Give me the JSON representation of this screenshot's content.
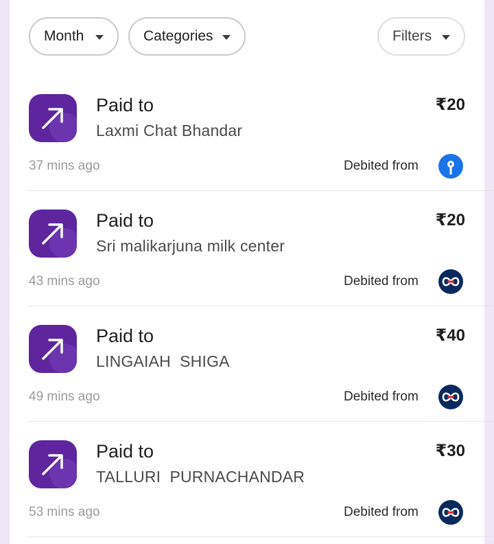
{
  "filters": {
    "month_label": "Month",
    "categories_label": "Categories",
    "filters_label": "Filters"
  },
  "transactions": [
    {
      "type_label": "Paid to",
      "payee": "Laxmi Chat Bhandar",
      "amount": "₹20",
      "time": "37 mins ago",
      "debited_label": "Debited from",
      "bank_icon": "sbi-bank-icon"
    },
    {
      "type_label": "Paid to",
      "payee": "Sri malikarjuna milk center",
      "amount": "₹20",
      "time": "43 mins ago",
      "debited_label": "Debited from",
      "bank_icon": "kotak-bank-icon"
    },
    {
      "type_label": "Paid to",
      "payee": "LINGAIAH  SHIGA",
      "amount": "₹40",
      "time": "49 mins ago",
      "debited_label": "Debited from",
      "bank_icon": "kotak-bank-icon"
    },
    {
      "type_label": "Paid to",
      "payee": "TALLURI  PURNACHANDAR",
      "amount": "₹30",
      "time": "53 mins ago",
      "debited_label": "Debited from",
      "bank_icon": "kotak-bank-icon"
    }
  ],
  "colors": {
    "brand_purple": "#5f259f",
    "sbi_blue": "#1a73e8",
    "kotak_navy": "#0a2a5e",
    "kotak_red": "#e0262d"
  }
}
